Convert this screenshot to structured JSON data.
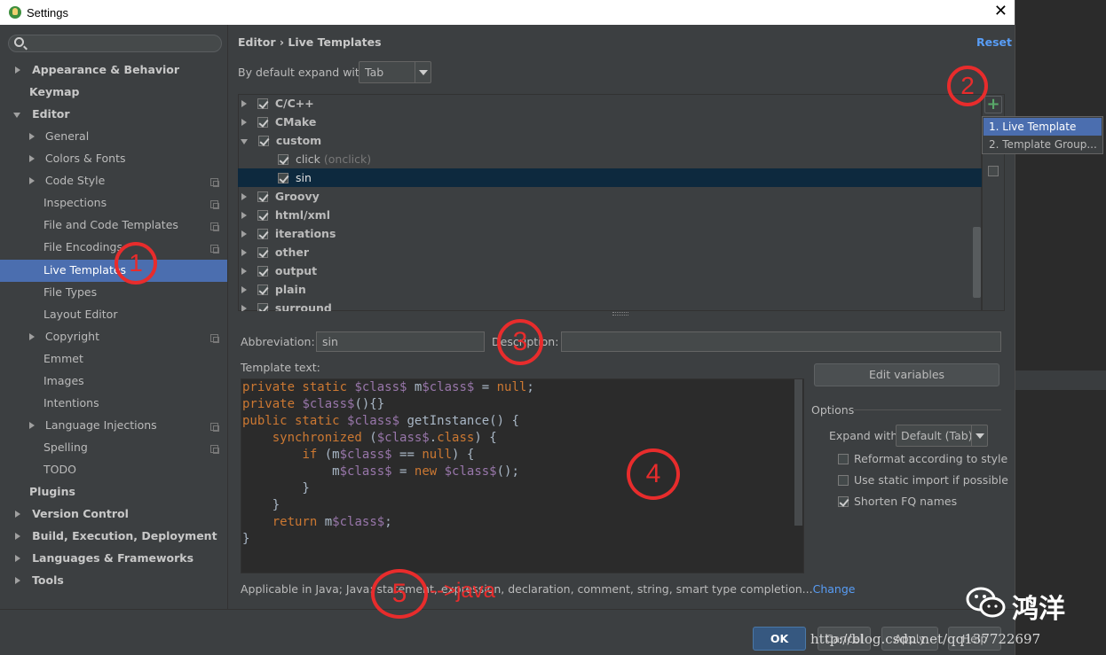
{
  "window": {
    "title": "Settings",
    "close_glyph": "✕"
  },
  "sidebar": {
    "search_placeholder": "",
    "items": [
      {
        "label": "Appearance & Behavior"
      },
      {
        "label": "Keymap"
      },
      {
        "label": "Editor"
      },
      {
        "label": "General"
      },
      {
        "label": "Colors & Fonts"
      },
      {
        "label": "Code Style"
      },
      {
        "label": "Inspections"
      },
      {
        "label": "File and Code Templates"
      },
      {
        "label": "File Encodings"
      },
      {
        "label": "Live Templates"
      },
      {
        "label": "File Types"
      },
      {
        "label": "Layout Editor"
      },
      {
        "label": "Copyright"
      },
      {
        "label": "Emmet"
      },
      {
        "label": "Images"
      },
      {
        "label": "Intentions"
      },
      {
        "label": "Language Injections"
      },
      {
        "label": "Spelling"
      },
      {
        "label": "TODO"
      },
      {
        "label": "Plugins"
      },
      {
        "label": "Version Control"
      },
      {
        "label": "Build, Execution, Deployment"
      },
      {
        "label": "Languages & Frameworks"
      },
      {
        "label": "Tools"
      }
    ]
  },
  "header": {
    "crumb_parent": "Editor",
    "crumb_sep": "›",
    "crumb_current": "Live Templates",
    "reset": "Reset"
  },
  "expand": {
    "label": "By default expand with",
    "value": "Tab"
  },
  "template_tree": {
    "groups": [
      {
        "label": "C/C++"
      },
      {
        "label": "CMake"
      },
      {
        "label": "custom"
      },
      {
        "label": "click"
      },
      {
        "label": "(onclick)"
      },
      {
        "label": "sin"
      },
      {
        "label": "Groovy"
      },
      {
        "label": "html/xml"
      },
      {
        "label": "iterations"
      },
      {
        "label": "other"
      },
      {
        "label": "output"
      },
      {
        "label": "plain"
      },
      {
        "label": "surround"
      }
    ]
  },
  "add_menu": {
    "plus": "+",
    "item1": "1. Live Template",
    "item2": "2. Template Group..."
  },
  "form": {
    "abbr_label": "Abbreviation:",
    "abbr_value": "sin",
    "desc_label": "Description:",
    "desc_value": "",
    "template_text_label": "Template text:",
    "edit_variables": "Edit variables"
  },
  "code_lines": [
    "private static $class$ m$class$ = null;",
    "private $class$(){}",
    "public static $class$ getInstance() {",
    "    synchronized ($class$.class) {",
    "        if (m$class$ == null) {",
    "            m$class$ = new $class$();",
    "        }",
    "    }",
    "    return m$class$;",
    "}"
  ],
  "options": {
    "title": "Options",
    "expand_with_label": "Expand with",
    "expand_with_value": "Default (Tab)",
    "reformat": "Reformat according to style",
    "static_import": "Use static import if possible",
    "shorten_fq": "Shorten FQ names"
  },
  "applicable": {
    "text": "Applicable in Java; Java: statement, expression, declaration, comment, string, smart type completion...",
    "change": "Change"
  },
  "buttons": {
    "ok": "OK",
    "cancel": "Cancel",
    "apply": "Apply",
    "help": "Help"
  },
  "annotations": {
    "a1": "1",
    "a2": "2",
    "a3": "3",
    "a4": "4",
    "a5": "5",
    "arrow": "-->java"
  },
  "watermark": {
    "url": "http://blog.csdn.net/qq137722697",
    "name": "鸿洋"
  },
  "colors": {
    "accent": "#4b6eaf",
    "annotation": "#e82c2c",
    "link": "#589df6",
    "keyword": "#cc7832",
    "variable": "#9876aa"
  }
}
